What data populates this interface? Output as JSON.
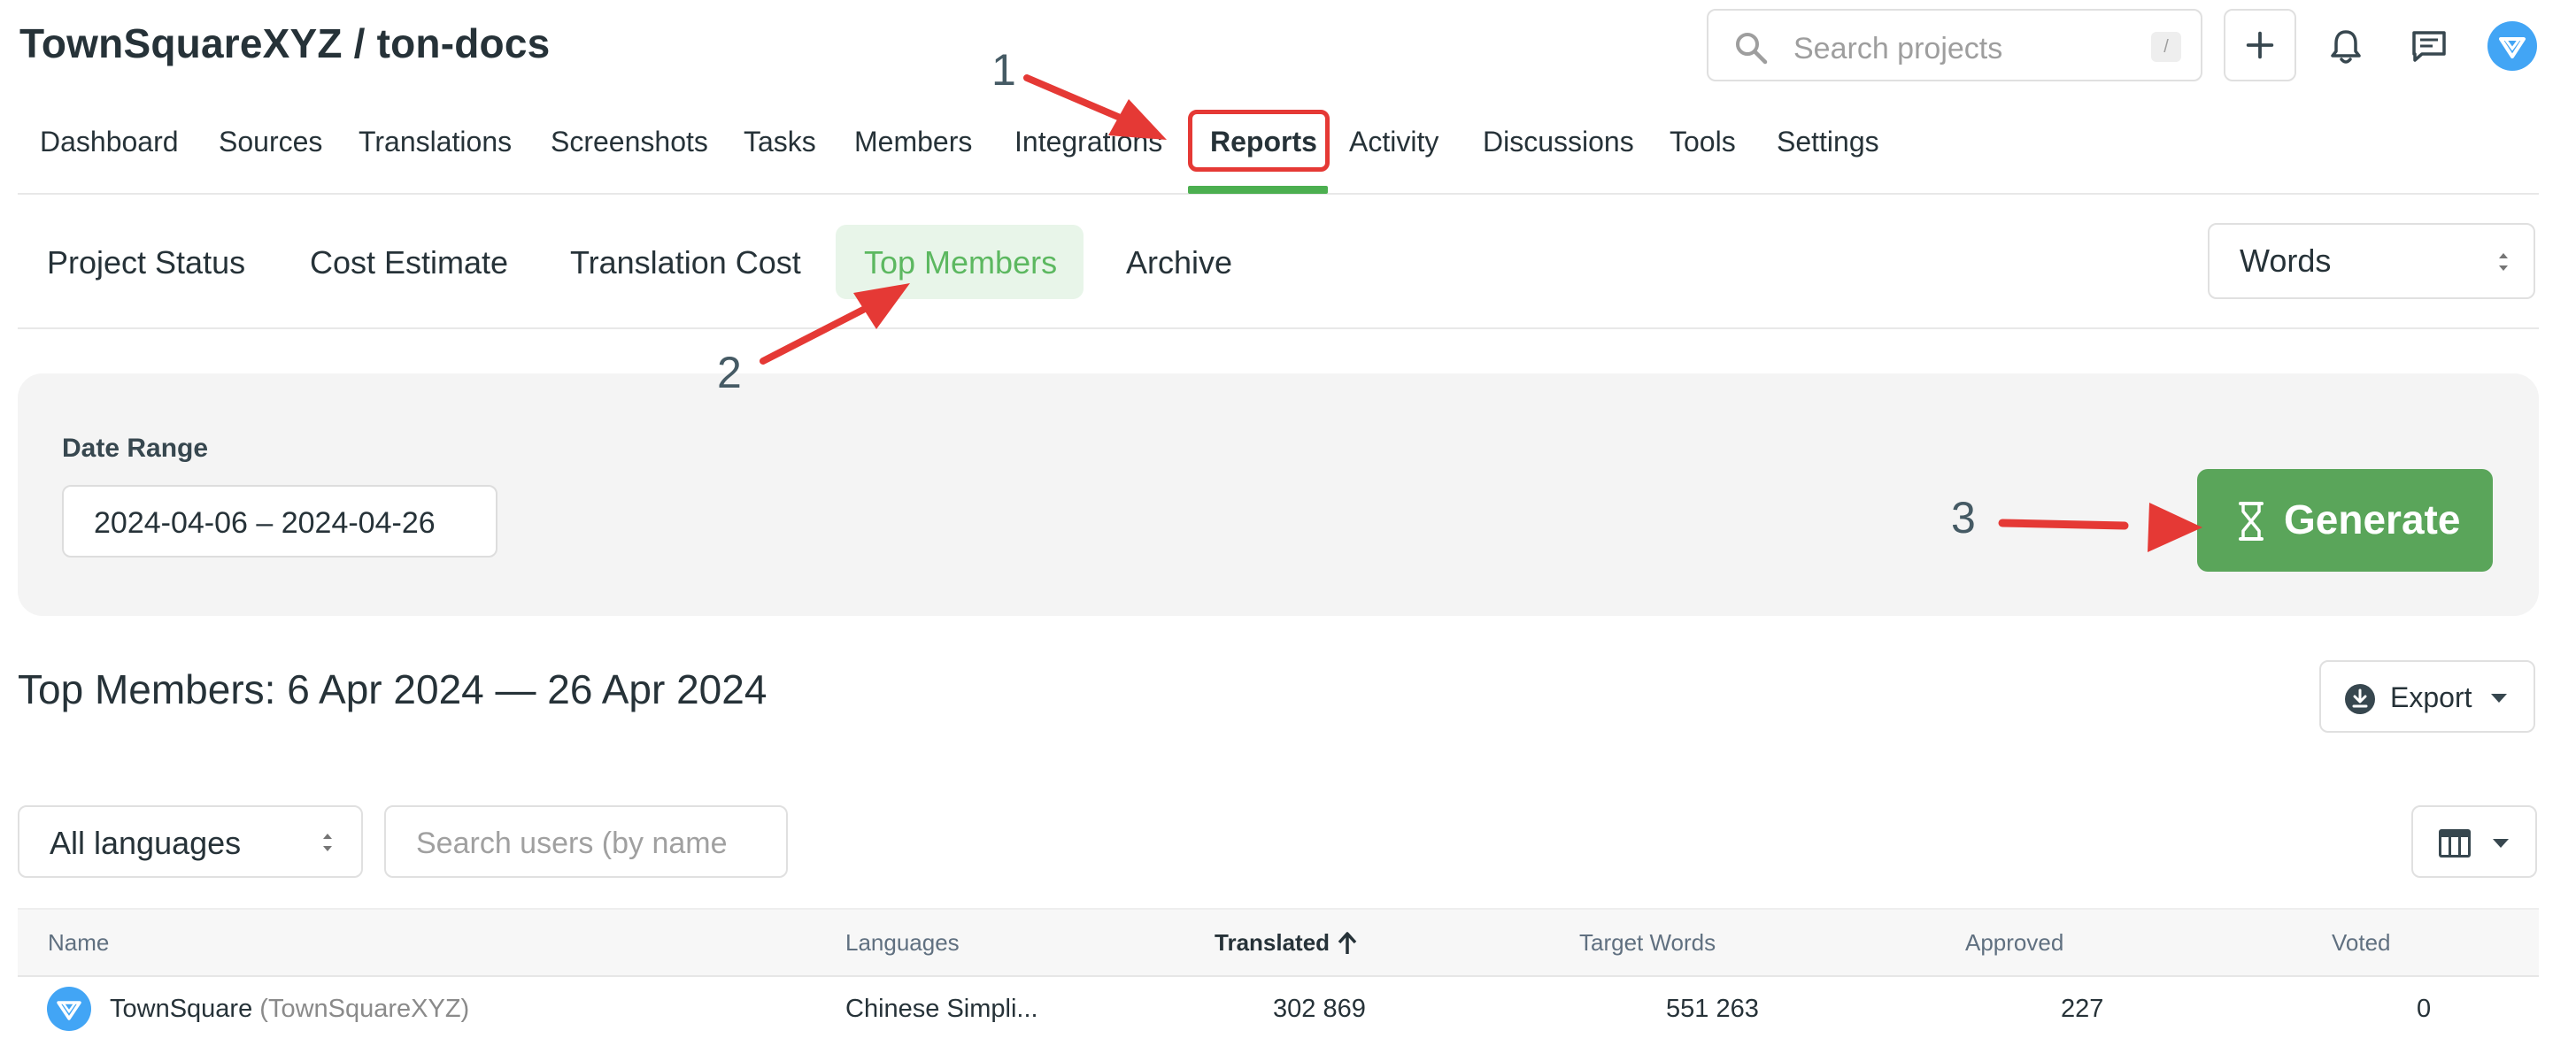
{
  "header": {
    "title": "TownSquareXYZ / ton-docs",
    "search_placeholder": "Search projects",
    "search_shortcut": "/"
  },
  "nav": {
    "items": [
      "Dashboard",
      "Sources",
      "Translations",
      "Screenshots",
      "Tasks",
      "Members",
      "Integrations",
      "Reports",
      "Activity",
      "Discussions",
      "Tools",
      "Settings"
    ],
    "active": "Reports"
  },
  "subtabs": {
    "items": [
      "Project Status",
      "Cost Estimate",
      "Translation Cost",
      "Top Members",
      "Archive"
    ],
    "active": "Top Members"
  },
  "unit_select": {
    "value": "Words"
  },
  "filters": {
    "date_range_label": "Date Range",
    "date_range_value": "2024-04-06 – 2024-04-26",
    "generate_label": "Generate"
  },
  "annotations": {
    "step1": "1",
    "step2": "2",
    "step3": "3"
  },
  "results": {
    "title": "Top Members: 6 Apr 2024 — 26 Apr 2024",
    "export_label": "Export",
    "language_select": "All languages",
    "user_search_placeholder": "Search users (by name"
  },
  "table": {
    "headers": [
      "Name",
      "Languages",
      "Translated",
      "Target Words",
      "Approved",
      "Voted"
    ],
    "sorted_by": "Translated",
    "rows": [
      {
        "name": "TownSquare",
        "username": "(TownSquareXYZ)",
        "languages": "Chinese Simpli...",
        "translated": "302 869",
        "target_words": "551 263",
        "approved": "227",
        "voted": "0"
      }
    ]
  },
  "colors": {
    "accent_green": "#4caf50",
    "generate_bg": "#5aa55a",
    "active_tab_bg": "#e8f5e9",
    "annotation_red": "#e53935",
    "logo_blue": "#42a5f5"
  },
  "icons": [
    "search-icon",
    "plus-icon",
    "bell-icon",
    "chat-icon",
    "crowdin-logo-icon",
    "sort-arrows-icon",
    "hourglass-icon",
    "download-icon",
    "caret-down-icon",
    "table-columns-icon",
    "sort-up-arrow-icon"
  ]
}
